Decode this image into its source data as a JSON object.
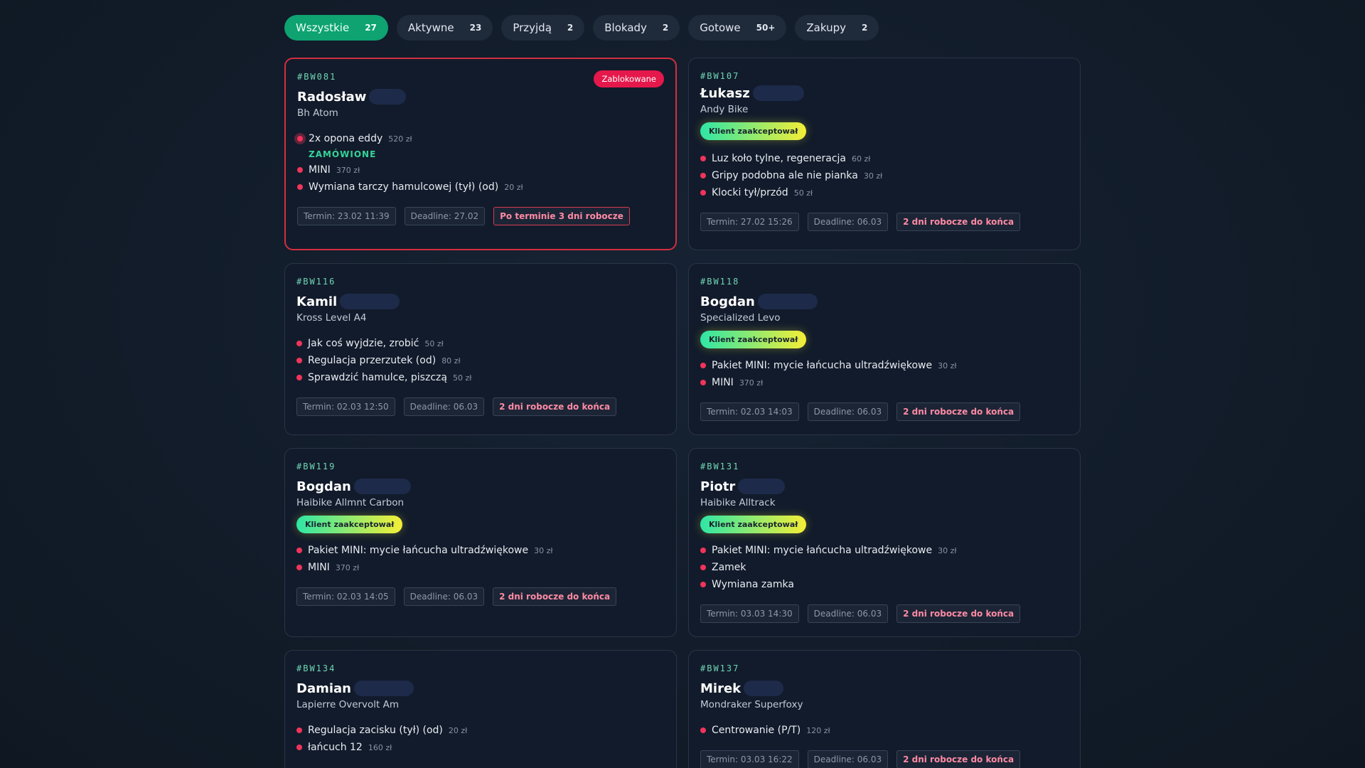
{
  "tabs": [
    {
      "label": "Wszystkie",
      "count": "27"
    },
    {
      "label": "Aktywne",
      "count": "23"
    },
    {
      "label": "Przyjdą",
      "count": "2"
    },
    {
      "label": "Blokady",
      "count": "2"
    },
    {
      "label": "Gotowe",
      "count": "50+"
    },
    {
      "label": "Zakupy",
      "count": "2"
    }
  ],
  "cards": [
    {
      "code": "#BW081",
      "name": "Radosław",
      "bike": "Bh Atom",
      "status": "Zablokowane",
      "items": [
        {
          "label": "2x opona eddy",
          "price": "520 zł",
          "note": "ZAMÓWIONE"
        },
        {
          "label": "MINI",
          "price": "370 zł"
        },
        {
          "label": "Wymiana tarczy hamulcowej (tył) (od)",
          "price": "20 zł"
        }
      ],
      "termin": "Termin: 23.02 11:39",
      "deadline": "Deadline: 27.02",
      "info": "Po terminie 3 dni robocze"
    },
    {
      "code": "#BW107",
      "name": "Łukasz",
      "bike": "Andy Bike",
      "accepted": "Klient zaakceptował",
      "items": [
        {
          "label": "Luz koło tylne, regeneracja",
          "price": "60 zł"
        },
        {
          "label": "Gripy podobna ale nie pianka",
          "price": "30 zł"
        },
        {
          "label": "Klocki tył/przód",
          "price": "50 zł"
        }
      ],
      "termin": "Termin: 27.02 15:26",
      "deadline": "Deadline: 06.03",
      "info": "2 dni robocze do końca"
    },
    {
      "code": "#BW116",
      "name": "Kamil",
      "bike": "Kross Level A4",
      "items": [
        {
          "label": "Jak coś wyjdzie, zrobić",
          "price": "50 zł"
        },
        {
          "label": "Regulacja przerzutek (od)",
          "price": "80 zł"
        },
        {
          "label": "Sprawdzić hamulce, piszczą",
          "price": "50 zł"
        }
      ],
      "termin": "Termin: 02.03 12:50",
      "deadline": "Deadline: 06.03",
      "info": "2 dni robocze do końca"
    },
    {
      "code": "#BW118",
      "name": "Bogdan",
      "bike": "Specialized Levo",
      "accepted": "Klient zaakceptował",
      "items": [
        {
          "label": "Pakiet MINI: mycie łańcucha ultradźwiękowe",
          "price": "30 zł"
        },
        {
          "label": "MINI",
          "price": "370 zł"
        }
      ],
      "termin": "Termin: 02.03 14:03",
      "deadline": "Deadline: 06.03",
      "info": "2 dni robocze do końca"
    },
    {
      "code": "#BW119",
      "name": "Bogdan",
      "bike": "Haibike Allmnt Carbon",
      "accepted": "Klient zaakceptował",
      "items": [
        {
          "label": "Pakiet MINI: mycie łańcucha ultradźwiękowe",
          "price": "30 zł"
        },
        {
          "label": "MINI",
          "price": "370 zł"
        }
      ],
      "termin": "Termin: 02.03 14:05",
      "deadline": "Deadline: 06.03",
      "info": "2 dni robocze do końca"
    },
    {
      "code": "#BW131",
      "name": "Piotr",
      "bike": "Haibike Alltrack",
      "accepted": "Klient zaakceptował",
      "items": [
        {
          "label": "Pakiet MINI: mycie łańcucha ultradźwiękowe",
          "price": "30 zł"
        },
        {
          "label": "Zamek",
          "price": ""
        },
        {
          "label": "Wymiana zamka",
          "price": ""
        }
      ],
      "termin": "Termin: 03.03 14:30",
      "deadline": "Deadline: 06.03",
      "info": "2 dni robocze do końca"
    },
    {
      "code": "#BW134",
      "name": "Damian",
      "bike": "Lapierre Overvolt Am",
      "items": [
        {
          "label": "Regulacja zacisku (tył) (od)",
          "price": "20 zł"
        },
        {
          "label": "łańcuch 12",
          "price": "160 zł"
        }
      ]
    },
    {
      "code": "#BW137",
      "name": "Mirek",
      "bike": "Mondraker Superfoxy",
      "items": [
        {
          "label": "Centrowanie (P/T)",
          "price": "120 zł"
        }
      ],
      "termin": "Termin: 03.03 16:22",
      "deadline": "Deadline: 06.03",
      "info": "2 dni robocze do końca"
    }
  ],
  "colors": {
    "accent": "#0ea371",
    "danger": "#e5184c",
    "dot": "#f0345a",
    "code": "#6ed6b4"
  }
}
